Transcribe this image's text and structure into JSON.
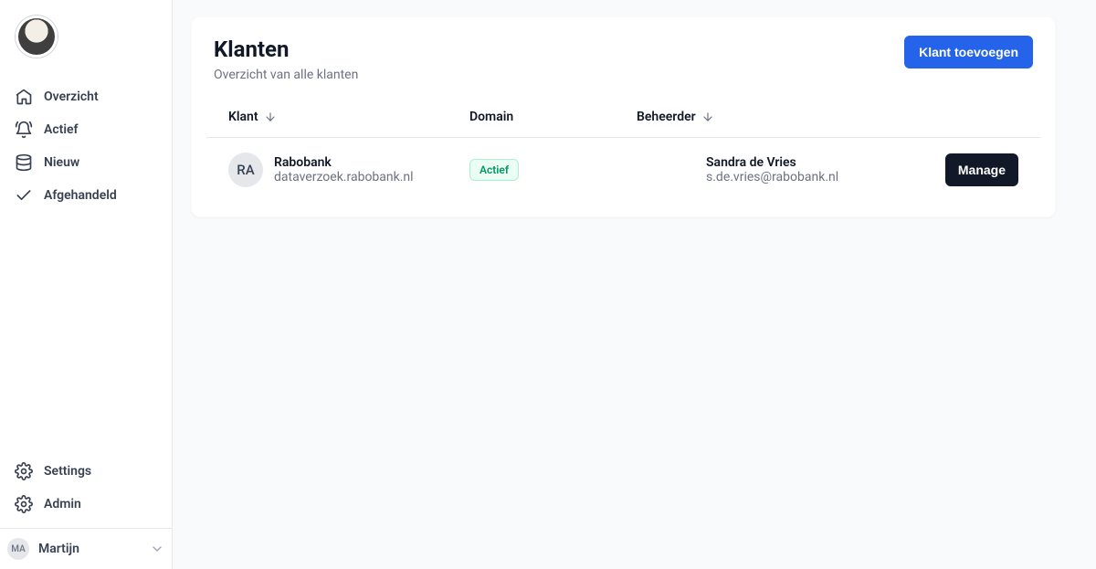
{
  "sidebar": {
    "nav": [
      {
        "label": "Overzicht"
      },
      {
        "label": "Actief"
      },
      {
        "label": "Nieuw"
      },
      {
        "label": "Afgehandeld"
      }
    ],
    "bottom": [
      {
        "label": "Settings"
      },
      {
        "label": "Admin"
      }
    ],
    "user": {
      "initials": "MA",
      "name": "Martijn"
    }
  },
  "page": {
    "title": "Klanten",
    "subtitle": "Overzicht van alle klanten",
    "add_button": "Klant toevoegen",
    "columns": {
      "client": "Klant",
      "domain": "Domain",
      "admin": "Beheerder"
    },
    "rows": [
      {
        "initials": "RA",
        "name": "Rabobank",
        "domain": "dataverzoek.rabobank.nl",
        "status": "Actief",
        "admin_name": "Sandra de Vries",
        "admin_email": "s.de.vries@rabobank.nl",
        "action": "Manage"
      }
    ]
  }
}
